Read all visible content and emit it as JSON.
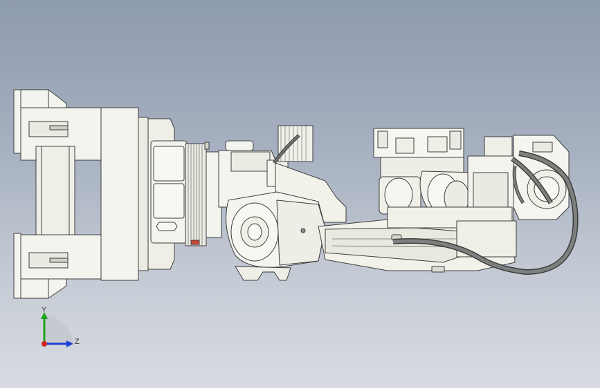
{
  "viewport": {
    "background_top": "#8e9aae",
    "background_bottom": "#d8dce2",
    "model_fill": "#f4f4ee",
    "model_stroke": "#3c3c3c"
  },
  "triad": {
    "y_label": "Y",
    "z_label": "Z",
    "y_color": "#1fa31f",
    "z_color": "#1f3fd6",
    "x_color": "#d01f1f"
  }
}
